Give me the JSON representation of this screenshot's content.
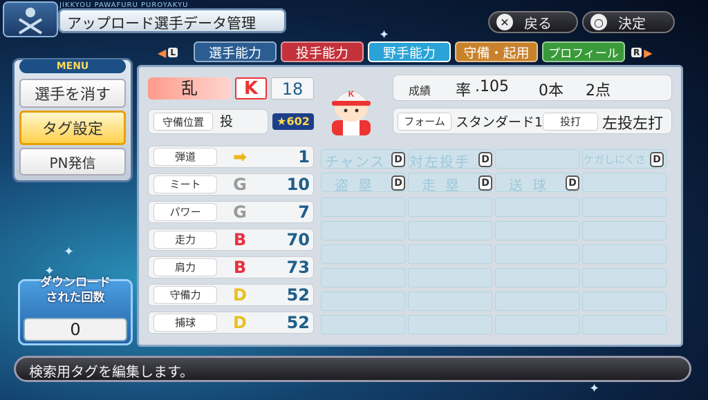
{
  "header": {
    "game_name": "JIKKYOU PAWAFURU PUROYAKYU",
    "title": "アップロード選手データ管理",
    "back_button": {
      "icon": "✕",
      "label": "戻る"
    },
    "confirm_button": {
      "icon": "○",
      "label": "決定"
    }
  },
  "tabs": {
    "left_key": "L",
    "right_key": "R",
    "items": [
      {
        "label": "選手能力",
        "color": "#2b5d93"
      },
      {
        "label": "投手能力",
        "color": "#c3323a"
      },
      {
        "label": "野手能力",
        "color": "#2aa4d8",
        "selected": true
      },
      {
        "label": "守備・起用",
        "color": "#c9822c"
      },
      {
        "label": "プロフィール",
        "color": "#3a9a3a"
      }
    ]
  },
  "menu": {
    "title": "MENU",
    "items": [
      {
        "label": "選手を消す"
      },
      {
        "label": "タグ設定",
        "selected": true
      },
      {
        "label": "PN発信"
      }
    ]
  },
  "downloads": {
    "label_line1": "ダウンロード",
    "label_line2": "された回数",
    "count": "0"
  },
  "player": {
    "name": "乱",
    "team_icon": "K",
    "number": "18",
    "position_label": "守備位置",
    "position": "投",
    "rating": "602",
    "stats_label": "成績",
    "avg_label": "率",
    "avg": ".105",
    "hr": "0本",
    "rbi": "2点",
    "form_label": "フォーム",
    "form": "スタンダード1",
    "bat_throw_label": "投打",
    "bat_throw": "左投左打"
  },
  "abilities": [
    {
      "label": "弾道",
      "grade": "➡",
      "grade_color": "#e8b820",
      "value": "1"
    },
    {
      "label": "ミート",
      "grade": "G",
      "grade_color": "#9a9a9a",
      "value": "10"
    },
    {
      "label": "パワー",
      "grade": "G",
      "grade_color": "#9a9a9a",
      "value": "7"
    },
    {
      "label": "走力",
      "grade": "B",
      "grade_color": "#e83040",
      "value": "70"
    },
    {
      "label": "肩力",
      "grade": "B",
      "grade_color": "#e83040",
      "value": "73"
    },
    {
      "label": "守備力",
      "grade": "D",
      "grade_color": "#e8c020",
      "value": "52"
    },
    {
      "label": "捕球",
      "grade": "D",
      "grade_color": "#e8c020",
      "value": "52"
    }
  ],
  "skills": {
    "row1": [
      {
        "label": "チャンス",
        "grade": "D"
      },
      {
        "label": "対左投手",
        "grade": "D"
      },
      {
        "label": "ケガしにくさ",
        "grade": "D"
      }
    ],
    "row2": [
      {
        "label": "盗塁",
        "grade": "D"
      },
      {
        "label": "走塁",
        "grade": "D"
      },
      {
        "label": "送球",
        "grade": "D"
      }
    ]
  },
  "help_text": "検索用タグを編集します。"
}
